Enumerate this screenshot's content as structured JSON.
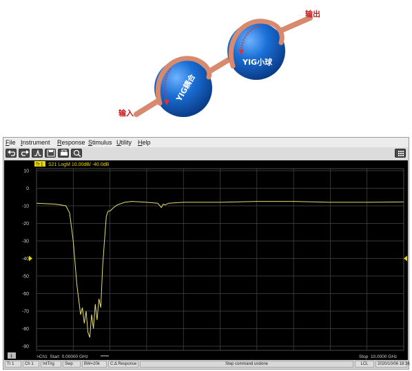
{
  "illustration": {
    "output_label": "输出",
    "input_label": "输入",
    "sphere_small_label": "YIG小球",
    "sphere_coupling_label": "YIG耦合"
  },
  "menu": [
    "File",
    "Instrument",
    "Response",
    "Stimulus",
    "Utility",
    "Help"
  ],
  "toolbar_icons": [
    "undo-icon",
    "redo-icon",
    "preset-icon",
    "save-icon",
    "print-icon",
    "zoom-icon",
    "grid-menu-icon"
  ],
  "trace": {
    "badge": "Tr 1",
    "header": "S21 LogM 10.00dB/ -40.0dB"
  },
  "footer": {
    "channel_badge": "1",
    "start": ">Ch1  Start  0.00000 GHz",
    "stop": "Stop  10.0000 GHz"
  },
  "status": {
    "items": [
      "Tr 1",
      "Ch 1",
      "IntTrig",
      "Swp",
      "BW=20k",
      "C:Δ Response"
    ],
    "message": "Step command undone",
    "lcl": "LCL",
    "datetime": "2020/10/06 18:36"
  },
  "colors": {
    "trace": "#e8e070",
    "marker": "#e8d800",
    "grid": "#4a4a4a"
  },
  "chart_data": {
    "type": "line",
    "title": "S21 LogM 10.00dB/ -40.0dB",
    "xlim": [
      0,
      10
    ],
    "ylim": [
      -95,
      15
    ],
    "yticks": [
      10,
      0,
      -10,
      -20,
      -30,
      -40,
      -50,
      -60,
      -70,
      -80,
      -90
    ],
    "x_divisions": 10,
    "reference_level": -40,
    "grid": true,
    "series": [
      {
        "x": [
          0,
          0.5,
          0.8,
          0.9,
          1.0,
          1.1,
          1.2,
          1.25,
          1.3,
          1.35,
          1.4,
          1.45,
          1.5,
          1.55,
          1.6,
          1.65,
          1.7,
          1.75,
          1.8,
          1.85,
          1.9,
          1.95,
          2.0,
          2.1,
          2.2,
          2.4,
          2.6,
          3.0,
          3.3,
          3.4,
          3.45,
          3.5,
          3.6,
          4.0,
          5.0,
          6.0,
          7.0,
          8.0,
          9.0,
          10.0
        ],
        "y": [
          -8.5,
          -9,
          -10,
          -14,
          -30,
          -55,
          -72,
          -68,
          -77,
          -70,
          -82,
          -85,
          -72,
          -80,
          -66,
          -75,
          -63,
          -68,
          -45,
          -30,
          -16,
          -13,
          -13,
          -11,
          -9.5,
          -8,
          -7.5,
          -8,
          -8.5,
          -11,
          -9,
          -9.5,
          -8.5,
          -8,
          -8,
          -7.5,
          -7.5,
          -8,
          -8,
          -7.8
        ]
      }
    ]
  }
}
